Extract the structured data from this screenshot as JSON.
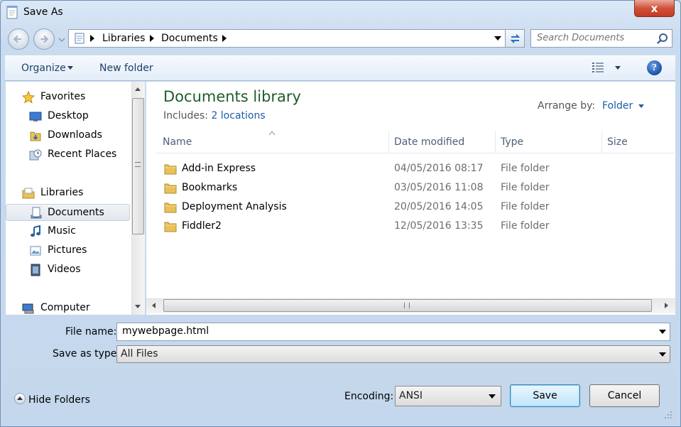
{
  "window": {
    "title": "Save As",
    "close_label": "x"
  },
  "address": {
    "crumbs": [
      "Libraries",
      "Documents"
    ],
    "search_placeholder": "Search Documents"
  },
  "toolbar": {
    "organize": "Organize",
    "new_folder": "New folder",
    "help": "?"
  },
  "nav": {
    "favorites": "Favorites",
    "desktop": "Desktop",
    "downloads": "Downloads",
    "recent": "Recent Places",
    "libraries": "Libraries",
    "documents": "Documents",
    "music": "Music",
    "pictures": "Pictures",
    "videos": "Videos",
    "computer": "Computer"
  },
  "library": {
    "title": "Documents library",
    "includes_label": "Includes:",
    "includes_link": "2 locations",
    "arrange_label": "Arrange by:",
    "arrange_value": "Folder"
  },
  "columns": {
    "name": "Name",
    "date": "Date modified",
    "type": "Type",
    "size": "Size"
  },
  "files": [
    {
      "name": "Add-in Express",
      "date": "04/05/2016 08:17",
      "type": "File folder"
    },
    {
      "name": "Bookmarks",
      "date": "03/05/2016 11:08",
      "type": "File folder"
    },
    {
      "name": "Deployment Analysis",
      "date": "20/05/2016 14:05",
      "type": "File folder"
    },
    {
      "name": "Fiddler2",
      "date": "12/05/2016 13:35",
      "type": "File folder"
    }
  ],
  "form": {
    "file_name_label": "File name:",
    "file_name_value": "mywebpage.html",
    "save_type_label": "Save as type:",
    "save_type_value": "All Files",
    "hide_folders": "Hide Folders",
    "encoding_label": "Encoding:",
    "encoding_value": "ANSI",
    "save": "Save",
    "cancel": "Cancel"
  },
  "colors": {
    "accent_green": "#1e5d2a",
    "link_blue": "#1c5da8",
    "close_red": "#c23b22"
  }
}
